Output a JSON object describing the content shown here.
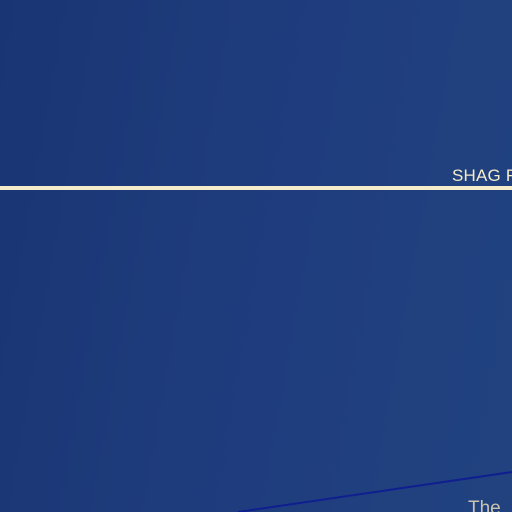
{
  "header": {
    "title_fragment": "SHAG F"
  },
  "content": {
    "bottom_fragment": "The"
  },
  "colors": {
    "background": "#1f3d7e",
    "accent_cream": "#f4eccb",
    "diagonal_line": "#0f1f8f",
    "muted_text": "#c9c3b0"
  }
}
